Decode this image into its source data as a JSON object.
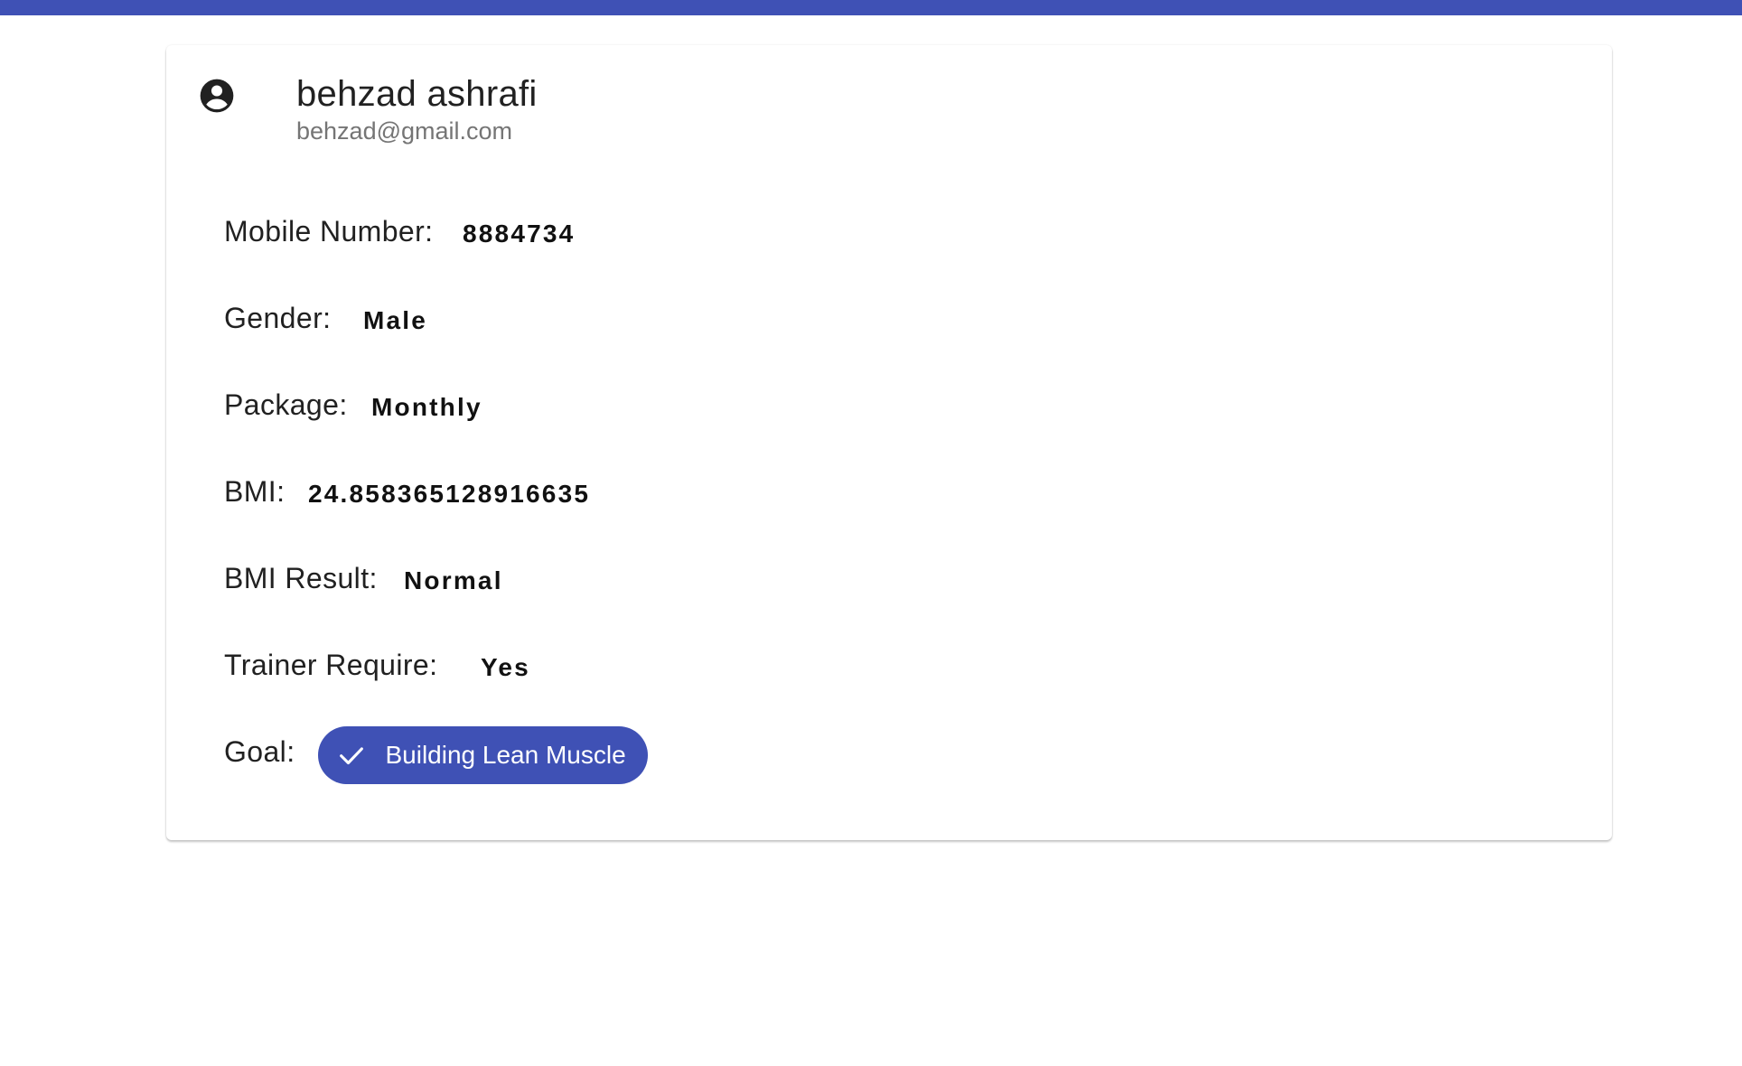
{
  "profile": {
    "name": "behzad ashrafi",
    "email": "behzad@gmail.com",
    "avatar_icon": "account-circle-icon"
  },
  "fields": [
    {
      "label": "Mobile Number:",
      "value": "8884734"
    },
    {
      "label": "Gender:",
      "value": "Male"
    },
    {
      "label": "Package:",
      "value": "Monthly"
    },
    {
      "label": "BMI:",
      "value": "24.858365128916635"
    },
    {
      "label": "BMI Result:",
      "value": "Normal"
    },
    {
      "label": "Trainer Require:",
      "value": "Yes"
    }
  ],
  "goal": {
    "label": "Goal:",
    "chip_label": "Building Lean Muscle",
    "chip_icon": "check-icon"
  },
  "colors": {
    "primary": "#3f51b5",
    "text": "#212121",
    "secondary_text": "#757575"
  }
}
